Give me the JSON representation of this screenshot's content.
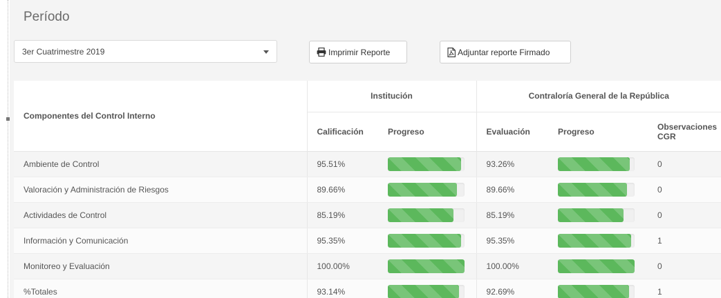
{
  "page": {
    "title": "Período"
  },
  "period_select": {
    "value": "3er Cuatrimestre 2019"
  },
  "toolbar": {
    "print_label": "Imprimir Reporte",
    "attach_label": "Adjuntar reporte Firmado"
  },
  "colors": {
    "progress_bar": "#5cb85c"
  },
  "table": {
    "header": {
      "component": "Componentes del Control Interno",
      "institution": "Institución",
      "cgr": "Contraloría General de la República",
      "calificacion": "Calificación",
      "progreso_inst": "Progreso",
      "evaluacion": "Evaluación",
      "progreso_cgr": "Progreso",
      "observaciones": "Observaciones CGR"
    },
    "rows": [
      {
        "component": "Ambiente de Control",
        "calificacion": "95.51%",
        "inst_progress": 95.51,
        "evaluacion": "93.26%",
        "cgr_progress": 93.26,
        "observaciones": "0"
      },
      {
        "component": "Valoración y Administración de Riesgos",
        "calificacion": "89.66%",
        "inst_progress": 89.66,
        "evaluacion": "89.66%",
        "cgr_progress": 89.66,
        "observaciones": "0"
      },
      {
        "component": "Actividades de Control",
        "calificacion": "85.19%",
        "inst_progress": 85.19,
        "evaluacion": "85.19%",
        "cgr_progress": 85.19,
        "observaciones": "0"
      },
      {
        "component": "Información y Comunicación",
        "calificacion": "95.35%",
        "inst_progress": 95.35,
        "evaluacion": "95.35%",
        "cgr_progress": 95.35,
        "observaciones": "1"
      },
      {
        "component": "Monitoreo y Evaluación",
        "calificacion": "100.00%",
        "inst_progress": 100.0,
        "evaluacion": "100.00%",
        "cgr_progress": 100.0,
        "observaciones": "0"
      },
      {
        "component": "%Totales",
        "calificacion": "93.14%",
        "inst_progress": 93.14,
        "evaluacion": "92.69%",
        "cgr_progress": 92.69,
        "observaciones": "1"
      }
    ]
  }
}
